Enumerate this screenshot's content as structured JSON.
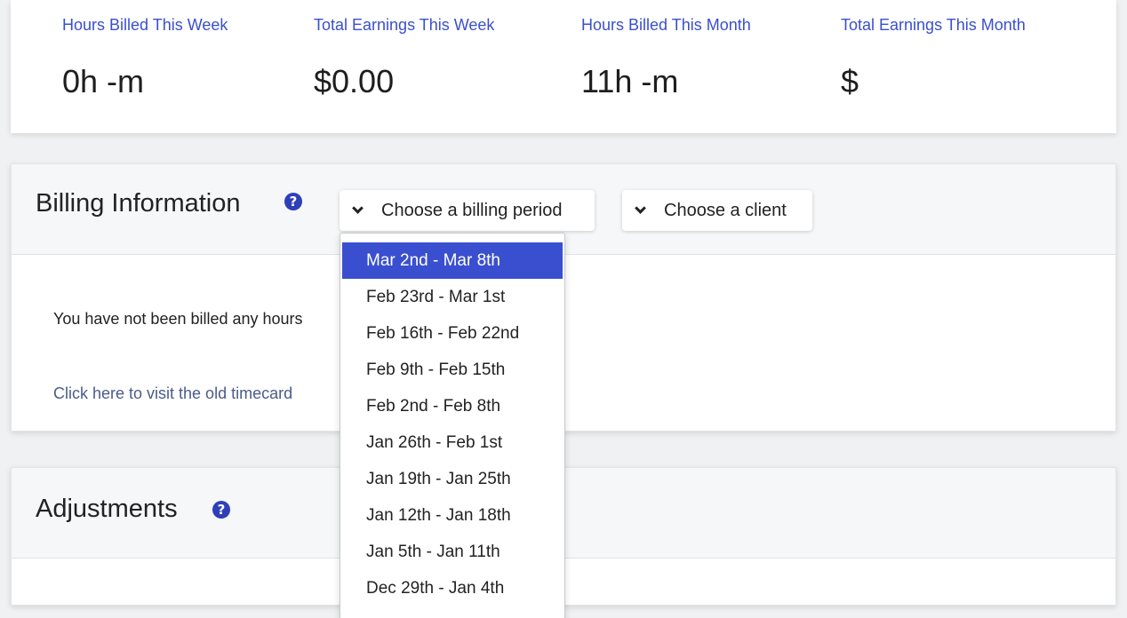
{
  "stats": [
    {
      "label": "Hours Billed This Week",
      "value": "0h -m"
    },
    {
      "label": "Total Earnings This Week",
      "value": "$0.00"
    },
    {
      "label": "Hours Billed This Month",
      "value": "11h -m"
    },
    {
      "label": "Total Earnings This Month",
      "value": "$"
    }
  ],
  "billing": {
    "title": "Billing Information",
    "help_icon": "question-circle-icon",
    "period_select": {
      "label": "Choose a billing period",
      "icon": "chevron-down-icon"
    },
    "client_select": {
      "label": "Choose a client",
      "icon": "chevron-down-icon"
    },
    "message": "You have not been billed any hours",
    "old_timecard_link": "Click here to visit the old timecard"
  },
  "period_options": [
    {
      "label": "Mar 2nd - Mar 8th",
      "selected": true
    },
    {
      "label": "Feb 23rd - Mar 1st",
      "selected": false
    },
    {
      "label": "Feb 16th - Feb 22nd",
      "selected": false
    },
    {
      "label": "Feb 9th - Feb 15th",
      "selected": false
    },
    {
      "label": "Feb 2nd - Feb 8th",
      "selected": false
    },
    {
      "label": "Jan 26th - Feb 1st",
      "selected": false
    },
    {
      "label": "Jan 19th - Jan 25th",
      "selected": false
    },
    {
      "label": "Jan 12th - Jan 18th",
      "selected": false
    },
    {
      "label": "Jan 5th - Jan 11th",
      "selected": false
    },
    {
      "label": "Dec 29th - Jan 4th",
      "selected": false
    }
  ],
  "adjustments": {
    "title": "Adjustments",
    "help_icon": "question-circle-icon"
  },
  "colors": {
    "accent": "#3a4fcf",
    "help_icon": "#2f3fb8",
    "link": "#4a5b8c"
  }
}
